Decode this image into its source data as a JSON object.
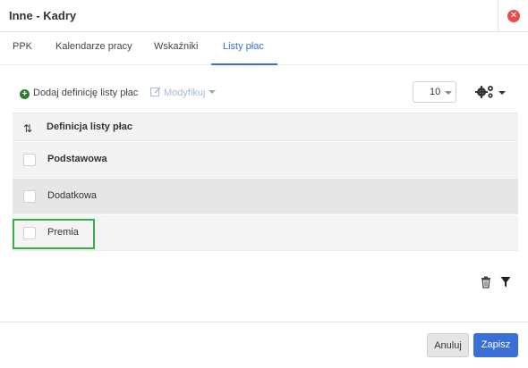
{
  "dialog": {
    "title": "Inne - Kadry",
    "close_icon": "close-circle-icon"
  },
  "tabs": [
    {
      "label": "PPK",
      "active": false
    },
    {
      "label": "Kalendarze pracy",
      "active": false
    },
    {
      "label": "Wskaźniki",
      "active": false
    },
    {
      "label": "Listy płac",
      "active": true
    }
  ],
  "toolbar": {
    "add_label": "Dodaj definicję listy płac",
    "edit_label": "Modyfikuj",
    "page_size": "10",
    "settings_icon": "gears-icon"
  },
  "grid": {
    "column_header": "Definicja listy płac",
    "rows": [
      {
        "label": "Podstawowa",
        "checked": false
      },
      {
        "label": "Dodatkowa",
        "checked": false
      },
      {
        "label": "Premia",
        "checked": false
      }
    ]
  },
  "footer": {
    "cancel_label": "Anuluj",
    "save_label": "Zapisz"
  },
  "colors": {
    "accent": "#3a6fd8",
    "highlight": "#35b04a",
    "close": "#e74c4c"
  }
}
